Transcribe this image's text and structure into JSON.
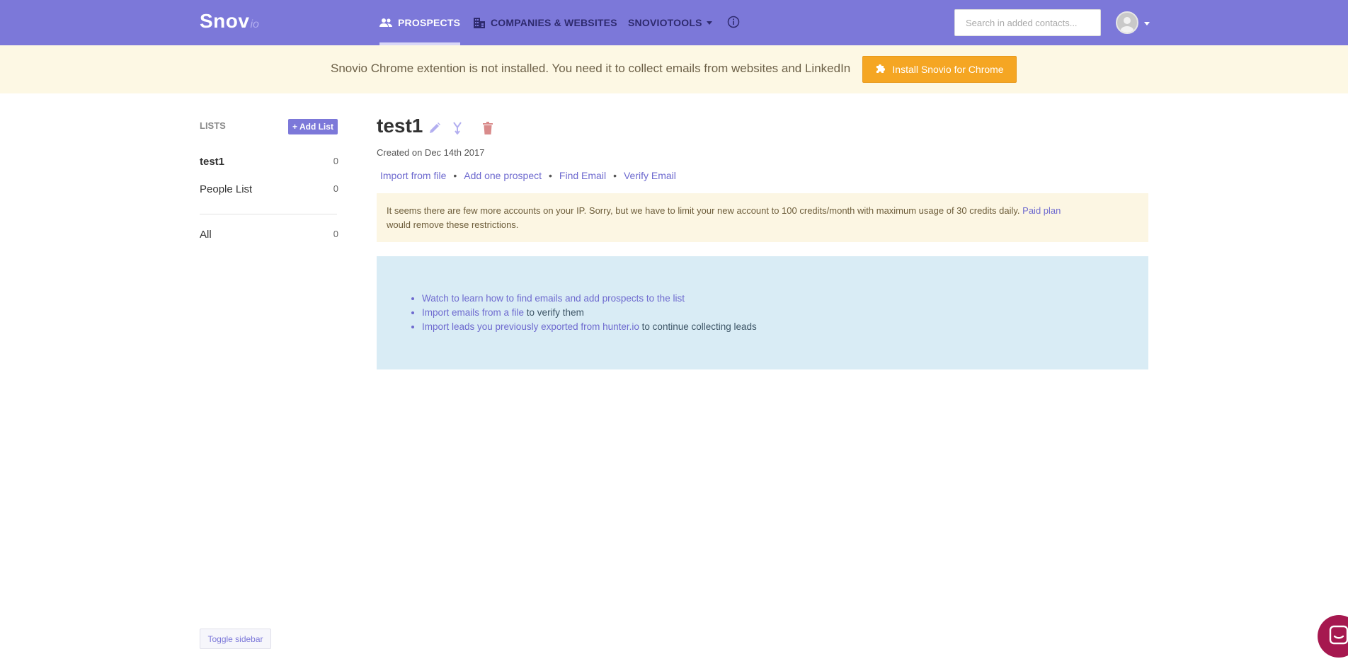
{
  "app": {
    "logo_main": "Snov",
    "logo_sub": "io"
  },
  "nav": {
    "prospects": "PROSPECTS",
    "companies": "COMPANIES & WEBSITES",
    "tools": "SNOVIOTOOLS",
    "search_placeholder": "Search in added contacts..."
  },
  "banner": {
    "text": "Snovio Chrome extention is not installed. You need it to collect emails from websites and LinkedIn",
    "install_button": "Install Snovio for Chrome"
  },
  "sidebar": {
    "heading": "LISTS",
    "add_list_button": "+ Add List",
    "lists": [
      {
        "name": "test1",
        "count": "0"
      },
      {
        "name": "People List",
        "count": "0"
      }
    ],
    "all": {
      "name": "All",
      "count": "0"
    },
    "toggle_button": "Toggle sidebar"
  },
  "main": {
    "title": "test1",
    "created": "Created on Dec 14th 2017",
    "actions": [
      "Import from file",
      "Add one prospect",
      "Find Email",
      "Verify Email"
    ],
    "alert": {
      "text": "It seems there are few more accounts on your IP. Sorry, but we have to limit your new account to 100 credits/month with maximum usage of 30 credits daily.",
      "link": "Paid plan",
      "text_after": "would remove these restrictions."
    },
    "info": [
      {
        "link": "Watch to learn how to find emails and add prospects to the list",
        "text": ""
      },
      {
        "link": "Import emails from a file",
        "text": " to verify them"
      },
      {
        "link": "Import leads you previously exported from hunter.io",
        "text": " to continue collecting leads"
      }
    ]
  },
  "colors": {
    "nav_bg": "#7c78d9",
    "banner_bg": "#fdf8e4",
    "install_button": "#f5a623",
    "alert_bg": "#fcf6e3",
    "info_bg": "#d9ecf5",
    "chat_bg": "#a6184f",
    "link": "#6e6acf"
  },
  "icons": {
    "prospects": "people-icon",
    "companies": "building-icon",
    "info": "info-circle-icon",
    "install": "puzzle-icon",
    "edit": "pencil-icon",
    "merge": "merge-icon",
    "delete": "trash-icon",
    "chat": "chat-icon"
  }
}
